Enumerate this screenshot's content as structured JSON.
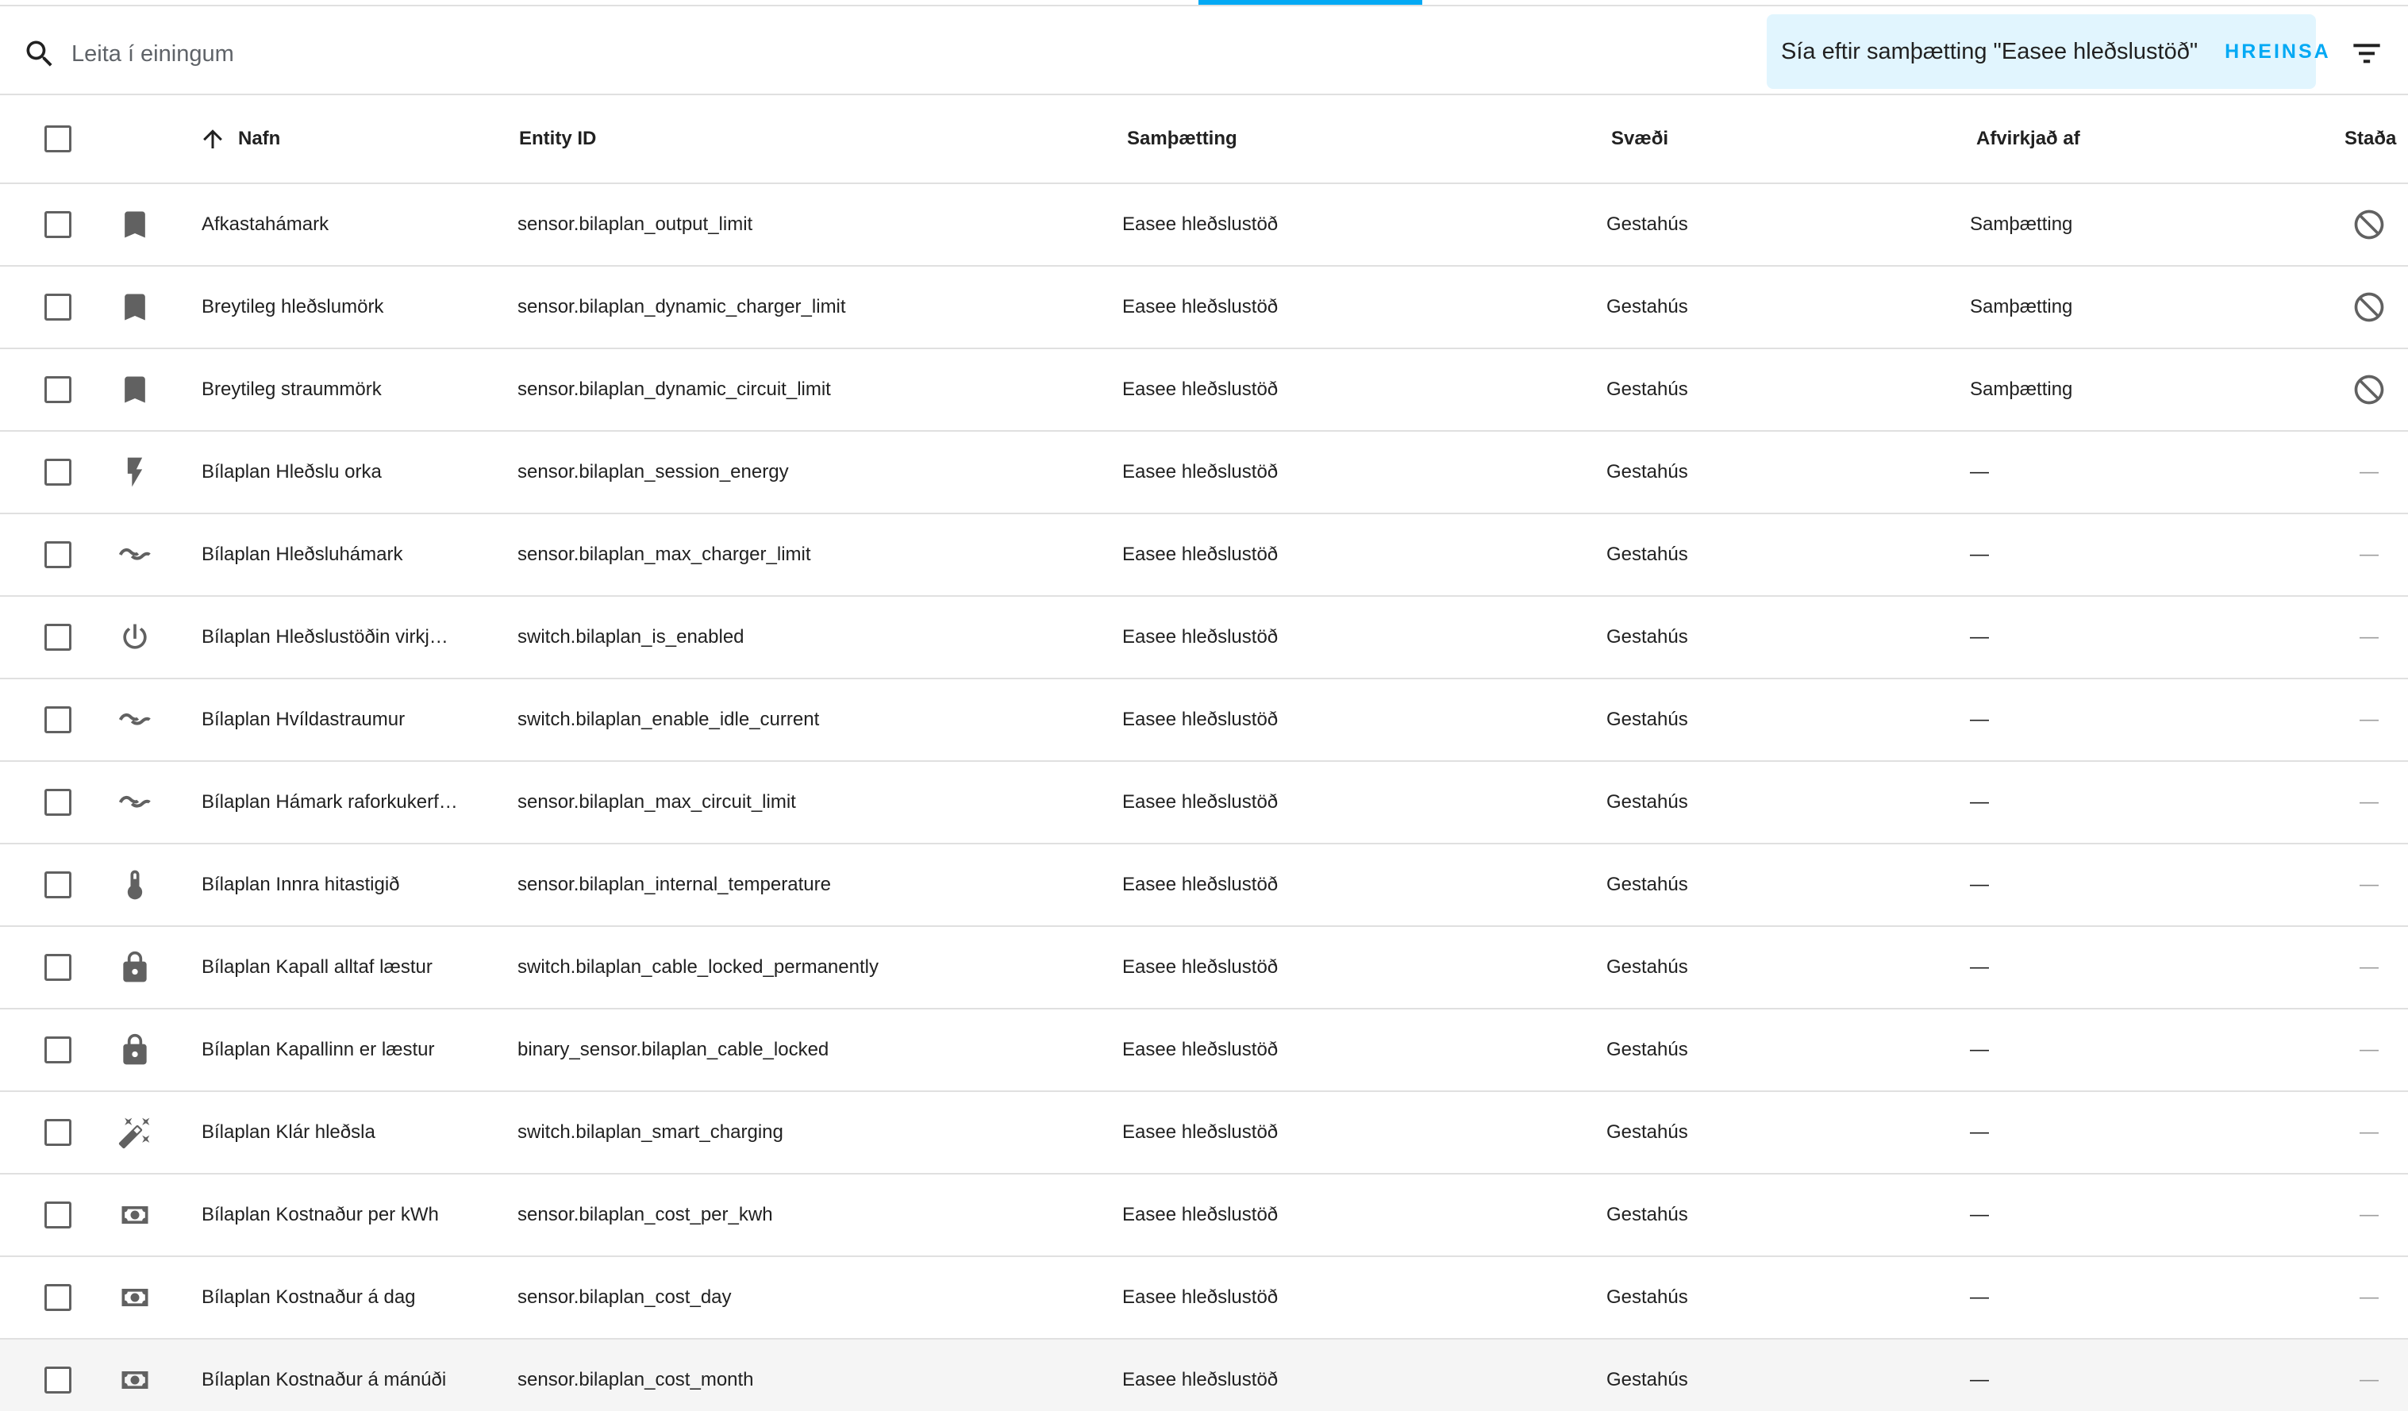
{
  "search": {
    "placeholder": "Leita í einingum",
    "filter_text": "Sía eftir samþætting \"Easee hleðslustöð\"",
    "clear_label": "HREINSA"
  },
  "columns": {
    "name": "Nafn",
    "entity_id": "Entity ID",
    "integration": "Samþætting",
    "area": "Svæði",
    "disabled_by": "Afvirkjað af",
    "status": "Staða"
  },
  "rows": [
    {
      "icon": "bookmark-icon",
      "name": "Afkastahámark",
      "entity_id": "sensor.bilaplan_output_limit",
      "integration": "Easee hleðslustöð",
      "area": "Gestahús",
      "disabled_by": "Samþætting",
      "status": "disabled-icon"
    },
    {
      "icon": "bookmark-icon",
      "name": "Breytileg hleðslumörk",
      "entity_id": "sensor.bilaplan_dynamic_charger_limit",
      "integration": "Easee hleðslustöð",
      "area": "Gestahús",
      "disabled_by": "Samþætting",
      "status": "disabled-icon"
    },
    {
      "icon": "bookmark-icon",
      "name": "Breytileg straummörk",
      "entity_id": "sensor.bilaplan_dynamic_circuit_limit",
      "integration": "Easee hleðslustöð",
      "area": "Gestahús",
      "disabled_by": "Samþætting",
      "status": "disabled-icon"
    },
    {
      "icon": "flash-icon",
      "name": "Bílaplan Hleðslu orka",
      "entity_id": "sensor.bilaplan_session_energy",
      "integration": "Easee hleðslustöð",
      "area": "Gestahús",
      "disabled_by": "—",
      "status": "—"
    },
    {
      "icon": "current-ac-icon",
      "name": "Bílaplan Hleðsluhámark",
      "entity_id": "sensor.bilaplan_max_charger_limit",
      "integration": "Easee hleðslustöð",
      "area": "Gestahús",
      "disabled_by": "—",
      "status": "—"
    },
    {
      "icon": "power-icon",
      "name": "Bílaplan Hleðslustöðin virkj…",
      "entity_id": "switch.bilaplan_is_enabled",
      "integration": "Easee hleðslustöð",
      "area": "Gestahús",
      "disabled_by": "—",
      "status": "—"
    },
    {
      "icon": "current-ac-icon",
      "name": "Bílaplan Hvíldastraumur",
      "entity_id": "switch.bilaplan_enable_idle_current",
      "integration": "Easee hleðslustöð",
      "area": "Gestahús",
      "disabled_by": "—",
      "status": "—"
    },
    {
      "icon": "current-ac-icon",
      "name": "Bílaplan Hámark raforkukerf…",
      "entity_id": "sensor.bilaplan_max_circuit_limit",
      "integration": "Easee hleðslustöð",
      "area": "Gestahús",
      "disabled_by": "—",
      "status": "—"
    },
    {
      "icon": "thermometer-icon",
      "name": "Bílaplan Innra hitastigið",
      "entity_id": "sensor.bilaplan_internal_temperature",
      "integration": "Easee hleðslustöð",
      "area": "Gestahús",
      "disabled_by": "—",
      "status": "—"
    },
    {
      "icon": "lock-icon",
      "name": "Bílaplan Kapall alltaf læstur",
      "entity_id": "switch.bilaplan_cable_locked_permanently",
      "integration": "Easee hleðslustöð",
      "area": "Gestahús",
      "disabled_by": "—",
      "status": "—"
    },
    {
      "icon": "lock-icon",
      "name": "Bílaplan Kapallinn er læstur",
      "entity_id": "binary_sensor.bilaplan_cable_locked",
      "integration": "Easee hleðslustöð",
      "area": "Gestahús",
      "disabled_by": "—",
      "status": "—"
    },
    {
      "icon": "magic-wand-icon",
      "name": "Bílaplan Klár hleðsla",
      "entity_id": "switch.bilaplan_smart_charging",
      "integration": "Easee hleðslustöð",
      "area": "Gestahús",
      "disabled_by": "—",
      "status": "—"
    },
    {
      "icon": "cash-icon",
      "name": "Bílaplan Kostnaður per kWh",
      "entity_id": "sensor.bilaplan_cost_per_kwh",
      "integration": "Easee hleðslustöð",
      "area": "Gestahús",
      "disabled_by": "—",
      "status": "—"
    },
    {
      "icon": "cash-icon",
      "name": "Bílaplan Kostnaður á dag",
      "entity_id": "sensor.bilaplan_cost_day",
      "integration": "Easee hleðslustöð",
      "area": "Gestahús",
      "disabled_by": "—",
      "status": "—"
    },
    {
      "icon": "cash-icon",
      "name": "Bílaplan Kostnaður á mánúði",
      "entity_id": "sensor.bilaplan_cost_month",
      "integration": "Easee hleðslustöð",
      "area": "Gestahús",
      "disabled_by": "—",
      "status": "—",
      "hovered": true
    }
  ],
  "colors": {
    "accent": "#03a9f4",
    "chip_background": "#e1f5fe",
    "icon": "#616161",
    "divider": "#e0e0e0",
    "hover_row": "#f5f5f5"
  }
}
